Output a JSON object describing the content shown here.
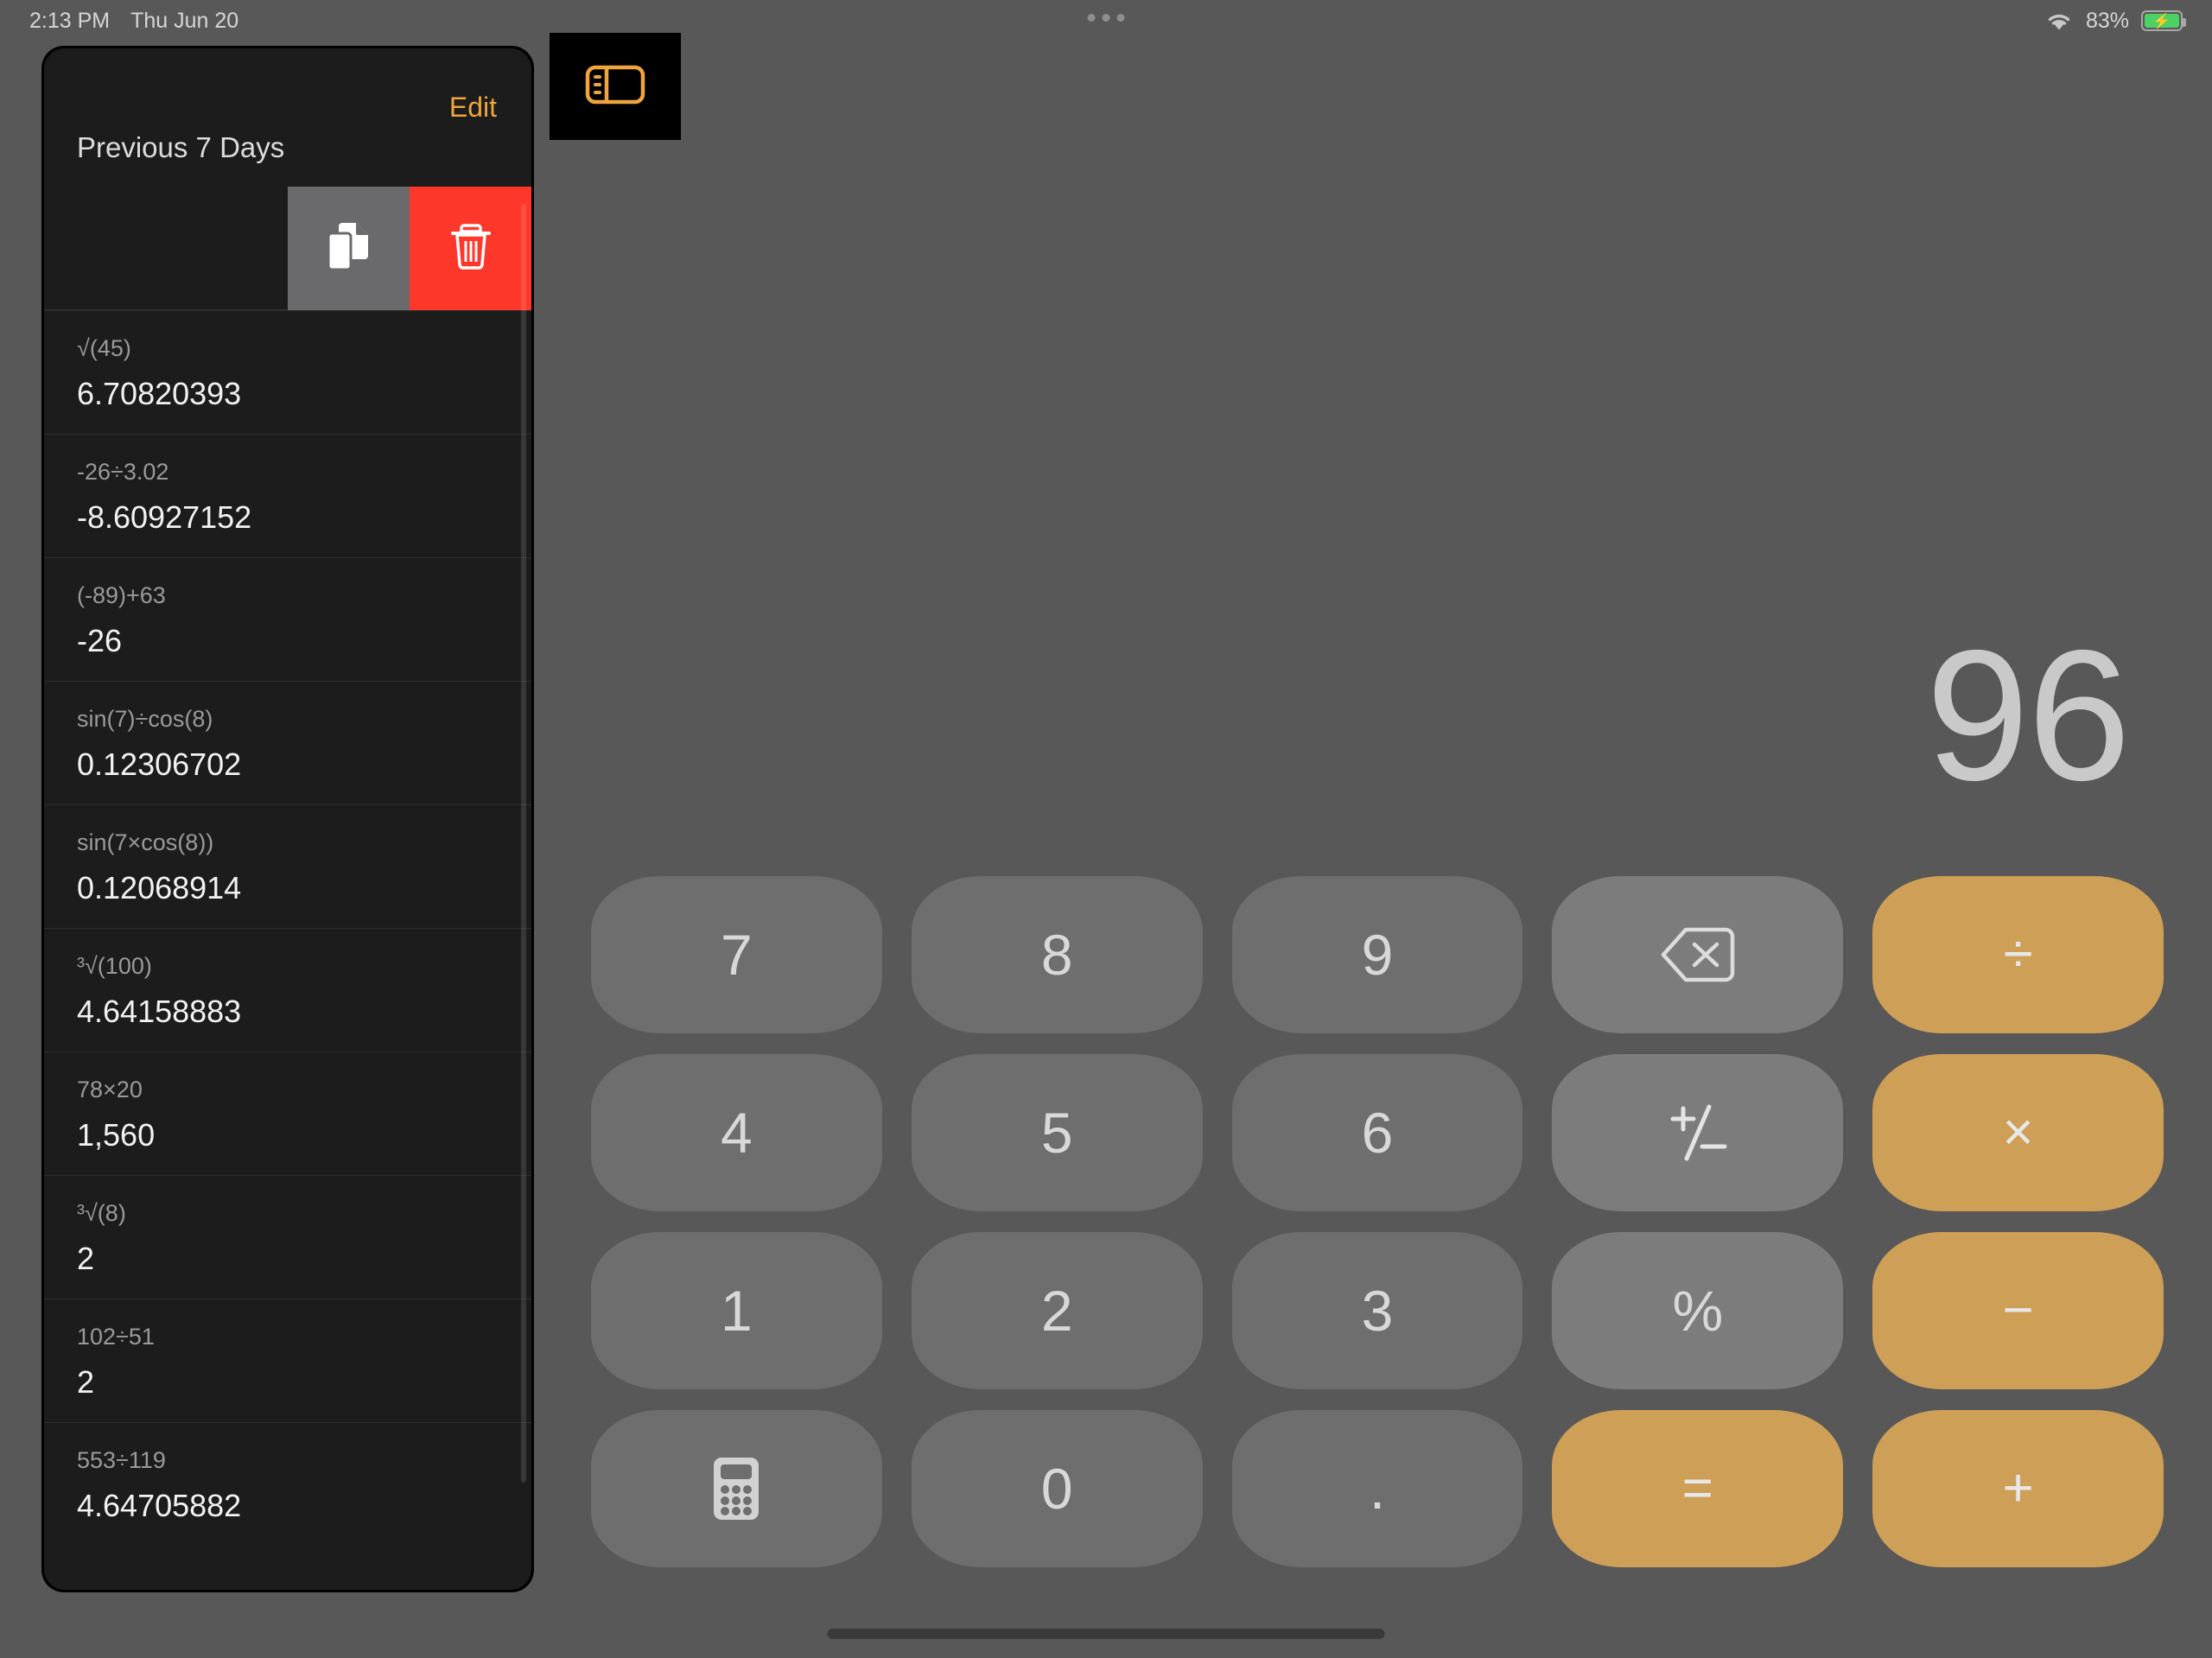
{
  "statusbar": {
    "time": "2:13 PM",
    "date": "Thu Jun 20",
    "battery_percent": "83%",
    "wifi_icon": "wifi-icon",
    "battery_icon": "battery-charging-icon",
    "multitask_icon": "multitasking-dots-icon"
  },
  "sidebar_toggle": {
    "icon": "sidebar-toggle-icon",
    "accent": "#f0a43c"
  },
  "history": {
    "edit_label": "Edit",
    "section_title": "Previous 7 Days",
    "swipe_actions": [
      {
        "name": "copy",
        "icon": "copy-icon",
        "color": "#6a6a6d"
      },
      {
        "name": "delete",
        "icon": "trash-icon",
        "color": "#fd382a"
      }
    ],
    "items": [
      {
        "expression": "√(45)",
        "result": "6.70820393"
      },
      {
        "expression": "-26÷3.02",
        "result": "-8.60927152"
      },
      {
        "expression": "(-89)+63",
        "result": "-26"
      },
      {
        "expression": "sin(7)÷cos(8)",
        "result": "0.12306702"
      },
      {
        "expression": "sin(7×cos(8))",
        "result": "0.12068914"
      },
      {
        "expression": "³√(100)",
        "result": "4.64158883"
      },
      {
        "expression": "78×20",
        "result": "1,560"
      },
      {
        "expression": "³√(8)",
        "result": "2"
      },
      {
        "expression": "102÷51",
        "result": "2"
      },
      {
        "expression": "553÷119",
        "result": "4.64705882"
      }
    ]
  },
  "calculator": {
    "display_value": "96",
    "colors": {
      "background": "#585858",
      "number_key": "#6e6e6e",
      "function_key": "#7c7c7c",
      "operator_key": "#ce9f57",
      "display_text": "#c9c9c9"
    },
    "keys": [
      {
        "id": "seven",
        "label": "7",
        "type": "num",
        "icon": null
      },
      {
        "id": "eight",
        "label": "8",
        "type": "num",
        "icon": null
      },
      {
        "id": "nine",
        "label": "9",
        "type": "num",
        "icon": null
      },
      {
        "id": "backspace",
        "label": "",
        "type": "fn",
        "icon": "backspace-icon"
      },
      {
        "id": "divide",
        "label": "÷",
        "type": "op",
        "icon": null
      },
      {
        "id": "four",
        "label": "4",
        "type": "num",
        "icon": null
      },
      {
        "id": "five",
        "label": "5",
        "type": "num",
        "icon": null
      },
      {
        "id": "six",
        "label": "6",
        "type": "num",
        "icon": null
      },
      {
        "id": "plus-minus",
        "label": "",
        "type": "fn",
        "icon": "plus-minus-icon"
      },
      {
        "id": "multiply",
        "label": "×",
        "type": "op",
        "icon": null
      },
      {
        "id": "one",
        "label": "1",
        "type": "num",
        "icon": null
      },
      {
        "id": "two",
        "label": "2",
        "type": "num",
        "icon": null
      },
      {
        "id": "three",
        "label": "3",
        "type": "num",
        "icon": null
      },
      {
        "id": "percent",
        "label": "%",
        "type": "fn",
        "icon": null
      },
      {
        "id": "minus",
        "label": "−",
        "type": "op",
        "icon": null
      },
      {
        "id": "mode",
        "label": "",
        "type": "num",
        "icon": "calculator-icon"
      },
      {
        "id": "zero",
        "label": "0",
        "type": "num",
        "icon": null
      },
      {
        "id": "decimal",
        "label": ".",
        "type": "num",
        "icon": null
      },
      {
        "id": "equals",
        "label": "=",
        "type": "op",
        "icon": null
      },
      {
        "id": "plus",
        "label": "+",
        "type": "op",
        "icon": null
      }
    ]
  }
}
